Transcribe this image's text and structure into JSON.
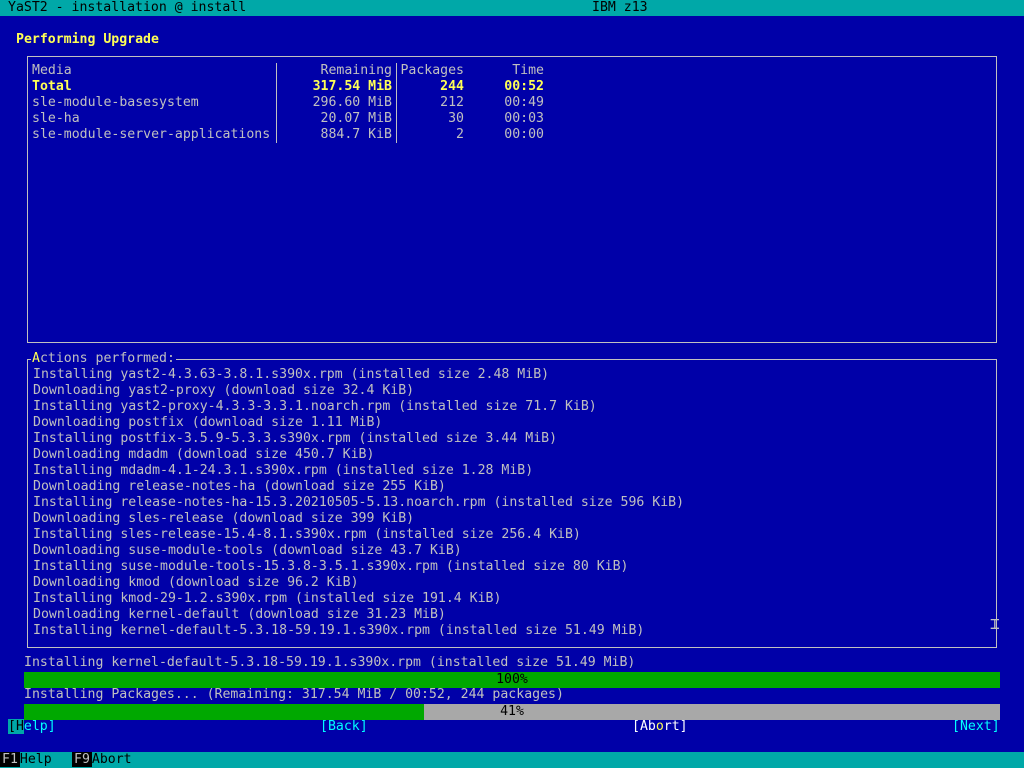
{
  "window": {
    "title": "YaST2 - installation @ install",
    "machine": "IBM z13"
  },
  "heading": "Performing Upgrade",
  "media_table": {
    "headers": {
      "media": "Media",
      "remaining": "Remaining",
      "packages": "Packages",
      "time": "Time"
    },
    "rows": [
      {
        "media": "Total",
        "remaining": "317.54 MiB",
        "packages": "244",
        "time": "00:52"
      },
      {
        "media": "sle-module-basesystem",
        "remaining": "296.60 MiB",
        "packages": "212",
        "time": "00:49"
      },
      {
        "media": "sle-ha",
        "remaining": "20.07 MiB",
        "packages": "30",
        "time": "00:03"
      },
      {
        "media": "sle-module-server-applications",
        "remaining": "884.7 KiB",
        "packages": "2",
        "time": "00:00"
      }
    ]
  },
  "actions": {
    "label_accel": "A",
    "label_rest": "ctions performed:",
    "lines": [
      "Installing yast2-4.3.63-3.8.1.s390x.rpm (installed size 2.48 MiB)",
      "Downloading yast2-proxy (download size 32.4 KiB)",
      "Installing yast2-proxy-4.3.3-3.3.1.noarch.rpm (installed size 71.7 KiB)",
      "Downloading postfix (download size 1.11 MiB)",
      "Installing postfix-3.5.9-5.3.3.s390x.rpm (installed size 3.44 MiB)",
      "Downloading mdadm (download size 450.7 KiB)",
      "Installing mdadm-4.1-24.3.1.s390x.rpm (installed size 1.28 MiB)",
      "Downloading release-notes-ha (download size 255 KiB)",
      "Installing release-notes-ha-15.3.20210505-5.13.noarch.rpm (installed size 596 KiB)",
      "Downloading sles-release (download size 399 KiB)",
      "Installing sles-release-15.4-8.1.s390x.rpm (installed size 256.4 KiB)",
      "Downloading suse-module-tools (download size 43.7 KiB)",
      "Installing suse-module-tools-15.3.8-3.5.1.s390x.rpm (installed size 80 KiB)",
      "Downloading kmod (download size 96.2 KiB)",
      "Installing kmod-29-1.2.s390x.rpm (installed size 191.4 KiB)",
      "Downloading kernel-default (download size 31.23 MiB)",
      "Installing kernel-default-5.3.18-59.19.1.s390x.rpm (installed size 51.49 MiB)"
    ]
  },
  "status": {
    "current_package": "Installing kernel-default-5.3.18-59.19.1.s390x.rpm (installed size 51.49 MiB)",
    "package_progress": {
      "percent": 100,
      "label": "100%"
    },
    "overall": "Installing Packages... (Remaining: 317.54 MiB / 00:52, 244 packages)",
    "overall_progress": {
      "percent": 41,
      "label": "41%"
    }
  },
  "buttons": {
    "help_open": "[",
    "help_accel": "H",
    "help_rest": "elp]",
    "back": "[Back]",
    "abort_a": "[Ab",
    "abort_accel": "o",
    "abort_b": "rt]",
    "next": "[Next]"
  },
  "fkeys": [
    {
      "key": "F1",
      "label": "Help"
    },
    {
      "key": "F9",
      "label": "Abort"
    }
  ],
  "icons": {
    "text_cursor": "text-cursor-icon"
  },
  "colors": {
    "background": "#0000a8",
    "titlebar": "#00a8a8",
    "highlight": "#ffff55",
    "progress_fill": "#00a800",
    "progress_track": "#a8a8a8"
  }
}
